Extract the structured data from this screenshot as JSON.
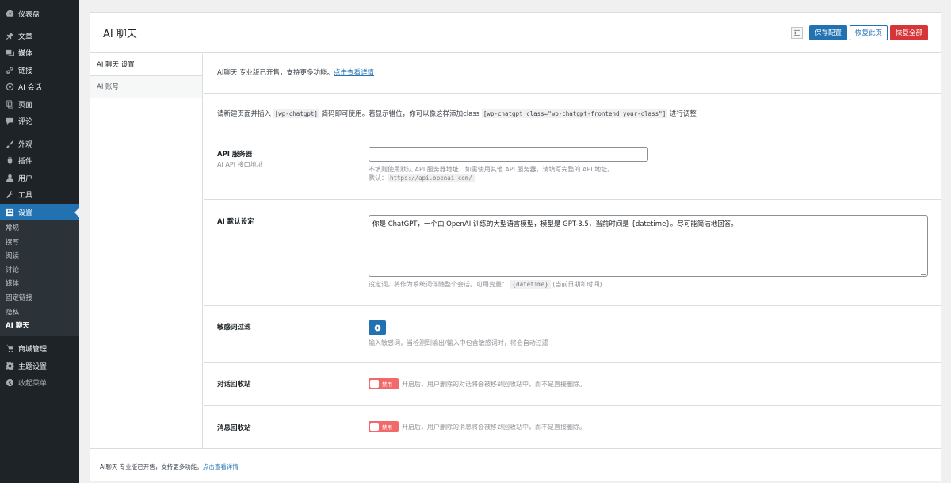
{
  "sidebar": {
    "items": [
      {
        "label": "仪表盘",
        "icon": "dashboard-icon"
      },
      {
        "label": "文章",
        "icon": "pin-icon"
      },
      {
        "label": "媒体",
        "icon": "media-icon"
      },
      {
        "label": "链接",
        "icon": "link-icon"
      },
      {
        "label": "AI 会话",
        "icon": "openai-icon"
      },
      {
        "label": "页面",
        "icon": "page-icon"
      },
      {
        "label": "评论",
        "icon": "comment-icon"
      },
      {
        "label": "外观",
        "icon": "brush-icon"
      },
      {
        "label": "插件",
        "icon": "plugin-icon"
      },
      {
        "label": "用户",
        "icon": "user-icon"
      },
      {
        "label": "工具",
        "icon": "wrench-icon"
      },
      {
        "label": "设置",
        "icon": "settings-icon"
      }
    ],
    "submenu": [
      "常规",
      "撰写",
      "阅读",
      "讨论",
      "媒体",
      "固定链接",
      "隐私",
      "AI 聊天"
    ],
    "bottom": [
      {
        "label": "商城管理",
        "icon": "cart-icon"
      },
      {
        "label": "主题设置",
        "icon": "gear-icon"
      },
      {
        "label": "收起菜单",
        "icon": "collapse-icon"
      }
    ]
  },
  "header": {
    "title": "AI 聊天",
    "save": "保存配置",
    "reset_page": "恢复此页",
    "reset_all": "恢复全部"
  },
  "tabs": [
    "AI 聊天 设置",
    "AI 账号"
  ],
  "notice": {
    "text": "AI聊天 专业版已开售，支持更多功能。",
    "link": "点击查看详情"
  },
  "shortcode": {
    "pre": "请新建页面并插入",
    "code1": "[wp-chatgpt]",
    "mid": "简码即可使用。若显示错位，你可以像这样添加class",
    "code2": "[wp-chatgpt class=\"wp-chatgpt-frontend your-class\"]",
    "post": "进行调整"
  },
  "api_server": {
    "label": "API 服务器",
    "sub": "AI API 接口地址",
    "value": "",
    "help": "不填则使用默认 API 服务器地址，如需使用其他 API 服务器，请填写完整的 API 地址。",
    "default_label": "默认：",
    "default_value": "https://api.openai.com/"
  },
  "ai_default": {
    "label": "AI 默认设定",
    "value": "你是 ChatGPT，一个由 OpenAI 训练的大型语言模型，模型是 GPT-3.5，当前时间是 {datetime}。尽可能简洁地回答。",
    "help_pre": "设定词，将作为系统词伴随整个会话。可用变量：",
    "help_var": "{datetime}",
    "help_post": "(当前日期和时间)"
  },
  "sensitive": {
    "label": "敏感词过滤",
    "help": "输入敏感词，当检测到输出/输入中包含敏感词时，将会自动过滤"
  },
  "conv_bin": {
    "label": "对话回收站",
    "toggle": "禁用",
    "help": "开启后，用户删除的对话将会被移到回收站中，而不是直接删除。"
  },
  "msg_bin": {
    "label": "消息回收站",
    "toggle": "禁用",
    "help": "开启后，用户删除的消息将会被移到回收站中，而不是直接删除。"
  },
  "footer": {
    "text": "AI聊天 专业版已开售，支持更多功能。",
    "link": "点击查看详情"
  }
}
